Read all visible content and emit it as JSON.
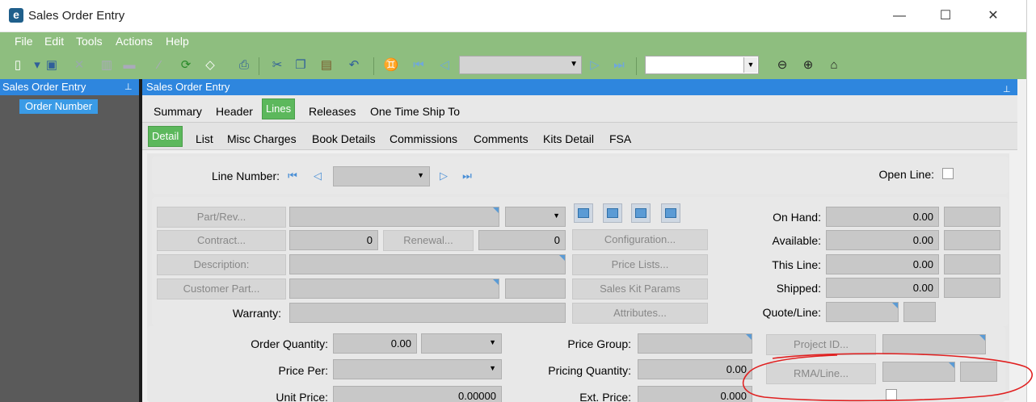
{
  "window": {
    "title": "Sales Order Entry",
    "minimize": "—",
    "maximize": "☐",
    "close": "✕",
    "app_icon": "e"
  },
  "menu": [
    "File",
    "Edit",
    "Tools",
    "Actions",
    "Help"
  ],
  "left_panel": {
    "header": "Sales Order Entry",
    "pin": "⊥",
    "tree_item": "Order Number"
  },
  "main": {
    "header": "Sales Order Entry",
    "pin": "⊥",
    "tabs1": [
      "Summary",
      "Header",
      "Lines",
      "Releases",
      "One Time Ship To"
    ],
    "active_tab1": "Lines",
    "tabs2": [
      "Detail",
      "List",
      "Misc Charges",
      "Book Details",
      "Commissions",
      "Comments",
      "Kits Detail",
      "FSA"
    ],
    "active_tab2": "Detail"
  },
  "line": {
    "label": "Line Number:",
    "open_line_label": "Open Line:"
  },
  "fields": {
    "part_rev": "Part/Rev...",
    "contract": "Contract...",
    "contract_value": "0",
    "renewal": "Renewal...",
    "renewal_value": "0",
    "description": "Description:",
    "customer_part": "Customer Part...",
    "warranty": "Warranty:",
    "configuration": "Configuration...",
    "price_lists": "Price Lists...",
    "sales_kit_params": "Sales Kit Params",
    "attributes": "Attributes..."
  },
  "stock": {
    "on_hand_label": "On Hand:",
    "on_hand": "0.00",
    "available_label": "Available:",
    "available": "0.00",
    "this_line_label": "This Line:",
    "this_line": "0.00",
    "shipped_label": "Shipped:",
    "shipped": "0.00",
    "quote_line_label": "Quote/Line:"
  },
  "pricing": {
    "order_qty_label": "Order Quantity:",
    "order_qty": "0.00",
    "price_per_label": "Price Per:",
    "unit_price_label": "Unit Price:",
    "unit_price": "0.00000",
    "price_group_label": "Price Group:",
    "pricing_qty_label": "Pricing Quantity:",
    "pricing_qty": "0.00",
    "ext_price_label": "Ext. Price:",
    "ext_price": "0.000",
    "project_id": "Project ID...",
    "rma_line": "RMA/Line..."
  },
  "colors": {
    "green": "#8ebe7f",
    "blue": "#2e86de",
    "annotation": "#e02020"
  }
}
